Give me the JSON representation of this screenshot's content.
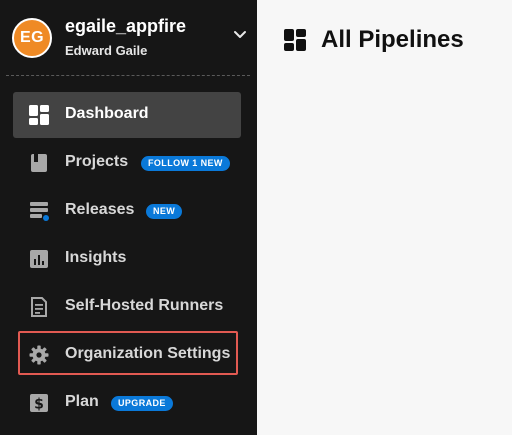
{
  "org": {
    "avatar_initials": "EG",
    "avatar_color": "#ef8a25",
    "name": "egaile_appfire",
    "user": "Edward Gaile",
    "chevron_icon": "chevron-down-icon"
  },
  "nav": {
    "items": [
      {
        "label": "Dashboard",
        "icon": "dashboard-grid-icon",
        "active": true
      },
      {
        "label": "Projects",
        "icon": "project-book-icon",
        "badge": "FOLLOW 1 NEW"
      },
      {
        "label": "Releases",
        "icon": "releases-icon",
        "badge": "NEW"
      },
      {
        "label": "Insights",
        "icon": "insights-chart-icon"
      },
      {
        "label": "Self-Hosted Runners",
        "icon": "runners-document-icon"
      },
      {
        "label": "Organization Settings",
        "icon": "gear-icon",
        "highlighted": true
      },
      {
        "label": "Plan",
        "icon": "dollar-icon",
        "badge": "UPGRADE"
      }
    ]
  },
  "main": {
    "title": "All Pipelines",
    "title_icon": "pipelines-grid-icon"
  },
  "colors": {
    "sidebar_bg": "#161616",
    "active_item_bg": "#434343",
    "badge_bg": "#0a79d9",
    "highlight_border": "#e25a52",
    "main_bg": "#f7f7f7"
  }
}
